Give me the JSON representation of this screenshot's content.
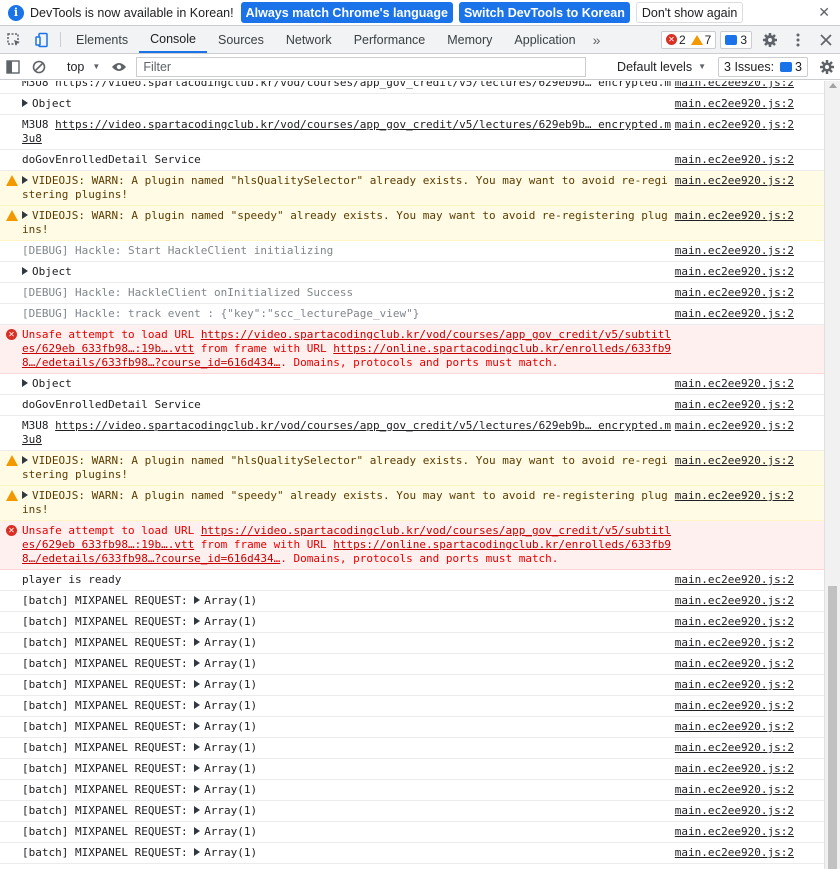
{
  "infobar": {
    "message": "DevTools is now available in Korean!",
    "match_language_button": "Always match Chrome's language",
    "switch_korean_button": "Switch DevTools to Korean",
    "dont_show_button": "Don't show again",
    "close_glyph": "✕"
  },
  "tabs": [
    "Elements",
    "Console",
    "Sources",
    "Network",
    "Performance",
    "Memory",
    "Application"
  ],
  "active_tab": "Console",
  "more_tabs_glyph": "»",
  "counters": {
    "errors": "2",
    "warnings": "7",
    "messages": "3"
  },
  "console_toolbar": {
    "context": "top",
    "filter_placeholder": "Filter",
    "levels": "Default levels",
    "issues_label": "3 Issues:",
    "issues_count": "3"
  },
  "colors": {
    "accent": "#1a73e8",
    "error": "#d93025",
    "warning": "#f29900"
  },
  "log": [
    {
      "type": "info",
      "text": "M3U8 https://video.spartacodingclub.kr/vod/courses/app_gov_credit/v5/lectures/629eb9b… encrypted.m",
      "source": "main.ec2ee920.js:2",
      "partial": true
    },
    {
      "type": "object",
      "text": "Object",
      "source": "main.ec2ee920.js:2"
    },
    {
      "type": "info",
      "prefix": "M3U8 ",
      "link": "https://video.spartacodingclub.kr/vod/courses/app_gov_credit/v5/lectures/629eb9b… encrypted.m3u8",
      "text": "",
      "source": "main.ec2ee920.js:2"
    },
    {
      "type": "info",
      "text": "doGovEnrolledDetail Service",
      "source": "main.ec2ee920.js:2"
    },
    {
      "type": "warn",
      "text": "VIDEOJS: WARN: A plugin named \"hlsQualitySelector\" already exists. You may want to avoid re-registering plugins!",
      "source": "main.ec2ee920.js:2"
    },
    {
      "type": "warn",
      "text": "VIDEOJS: WARN: A plugin named \"speedy\" already exists. You may want to avoid re-registering plugins!",
      "source": "main.ec2ee920.js:2"
    },
    {
      "type": "debug",
      "text": "[DEBUG] Hackle: Start HackleClient initializing",
      "source": "main.ec2ee920.js:2"
    },
    {
      "type": "object",
      "text": "Object",
      "source": "main.ec2ee920.js:2"
    },
    {
      "type": "debug",
      "text": "[DEBUG] Hackle: HackleClient onInitialized Success",
      "source": "main.ec2ee920.js:2"
    },
    {
      "type": "debug",
      "text": "[DEBUG] Hackle: track event : {\"key\":\"scc_lecturePage_view\"}",
      "source": "main.ec2ee920.js:2"
    },
    {
      "type": "error",
      "prefix": "Unsafe attempt to load URL ",
      "link": "https://video.spartacodingclub.kr/vod/courses/app_gov_credit/v5/subtitles/629eb 633fb98…:19b….vtt",
      "middle": " from frame with URL ",
      "link2": "https://online.spartacodingclub.kr/enrolleds/633fb98…/edetails/633fb98…?course_id=616d434…",
      "suffix": ". Domains, protocols and ports must match.",
      "source": ""
    },
    {
      "type": "object",
      "text": "Object",
      "source": "main.ec2ee920.js:2"
    },
    {
      "type": "info",
      "text": "doGovEnrolledDetail Service",
      "source": "main.ec2ee920.js:2"
    },
    {
      "type": "info",
      "prefix": "M3U8 ",
      "link": "https://video.spartacodingclub.kr/vod/courses/app_gov_credit/v5/lectures/629eb9b… encrypted.m3u8",
      "text": "",
      "source": "main.ec2ee920.js:2"
    },
    {
      "type": "warn",
      "text": "VIDEOJS: WARN: A plugin named \"hlsQualitySelector\" already exists. You may want to avoid re-registering plugins!",
      "source": "main.ec2ee920.js:2"
    },
    {
      "type": "warn",
      "text": "VIDEOJS: WARN: A plugin named \"speedy\" already exists. You may want to avoid re-registering plugins!",
      "source": "main.ec2ee920.js:2"
    },
    {
      "type": "error",
      "prefix": "Unsafe attempt to load URL ",
      "link": "https://video.spartacodingclub.kr/vod/courses/app_gov_credit/v5/subtitles/629eb 633fb98…:19b….vtt",
      "middle": " from frame with URL ",
      "link2": "https://online.spartacodingclub.kr/enrolleds/633fb98…/edetails/633fb98…?course_id=616d434…",
      "suffix": ". Domains, protocols and ports must match.",
      "source": ""
    },
    {
      "type": "info",
      "text": "player is ready",
      "source": "main.ec2ee920.js:2"
    },
    {
      "type": "batch",
      "text": "[batch] MIXPANEL REQUEST: ",
      "value": "Array(1)",
      "source": "main.ec2ee920.js:2"
    },
    {
      "type": "batch",
      "text": "[batch] MIXPANEL REQUEST: ",
      "value": "Array(1)",
      "source": "main.ec2ee920.js:2"
    },
    {
      "type": "batch",
      "text": "[batch] MIXPANEL REQUEST: ",
      "value": "Array(1)",
      "source": "main.ec2ee920.js:2"
    },
    {
      "type": "batch",
      "text": "[batch] MIXPANEL REQUEST: ",
      "value": "Array(1)",
      "source": "main.ec2ee920.js:2"
    },
    {
      "type": "batch",
      "text": "[batch] MIXPANEL REQUEST: ",
      "value": "Array(1)",
      "source": "main.ec2ee920.js:2"
    },
    {
      "type": "batch",
      "text": "[batch] MIXPANEL REQUEST: ",
      "value": "Array(1)",
      "source": "main.ec2ee920.js:2"
    },
    {
      "type": "batch",
      "text": "[batch] MIXPANEL REQUEST: ",
      "value": "Array(1)",
      "source": "main.ec2ee920.js:2"
    },
    {
      "type": "batch",
      "text": "[batch] MIXPANEL REQUEST: ",
      "value": "Array(1)",
      "source": "main.ec2ee920.js:2"
    },
    {
      "type": "batch",
      "text": "[batch] MIXPANEL REQUEST: ",
      "value": "Array(1)",
      "source": "main.ec2ee920.js:2"
    },
    {
      "type": "batch",
      "text": "[batch] MIXPANEL REQUEST: ",
      "value": "Array(1)",
      "source": "main.ec2ee920.js:2"
    },
    {
      "type": "batch",
      "text": "[batch] MIXPANEL REQUEST: ",
      "value": "Array(1)",
      "source": "main.ec2ee920.js:2"
    },
    {
      "type": "batch",
      "text": "[batch] MIXPANEL REQUEST: ",
      "value": "Array(1)",
      "source": "main.ec2ee920.js:2"
    },
    {
      "type": "batch",
      "text": "[batch] MIXPANEL REQUEST: ",
      "value": "Array(1)",
      "source": "main.ec2ee920.js:2"
    }
  ]
}
